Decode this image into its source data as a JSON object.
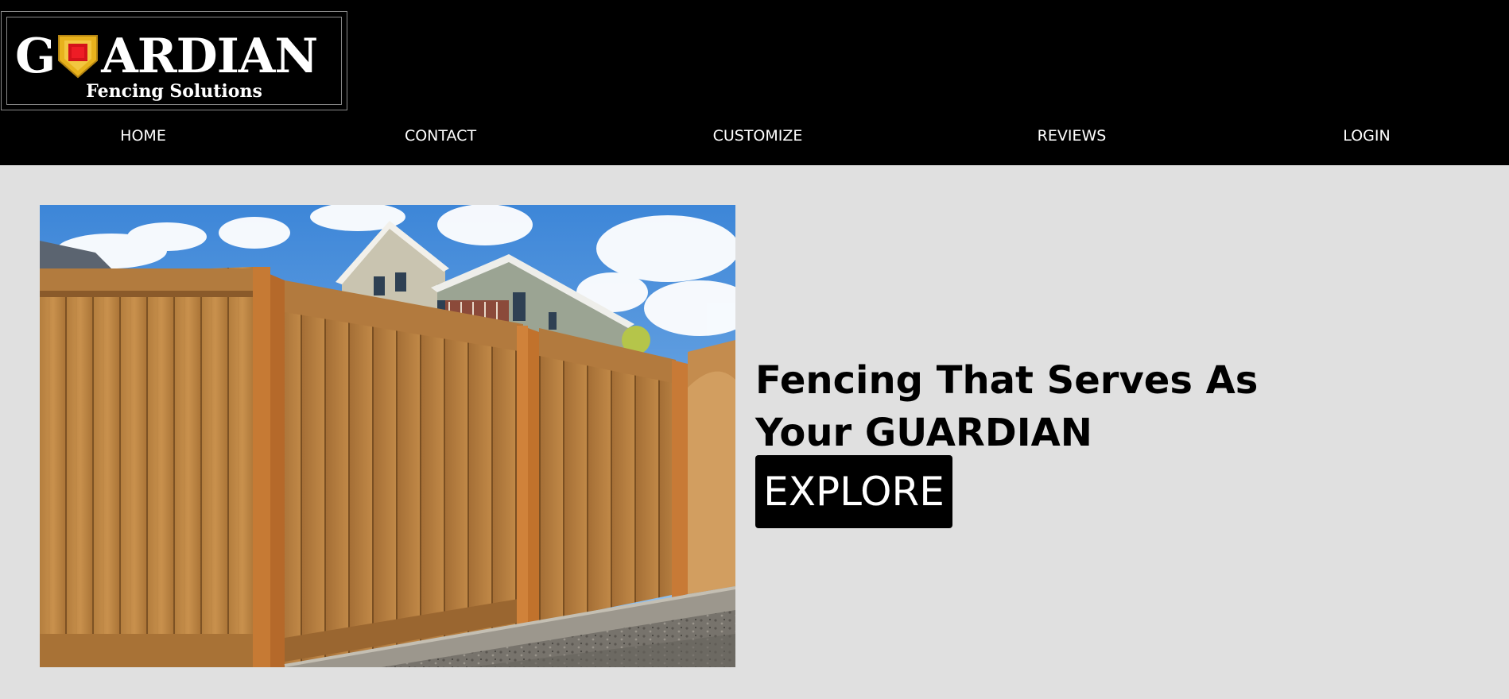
{
  "logo": {
    "word_left": "G",
    "word_right": "ARDIAN",
    "subtitle": "Fencing Solutions",
    "alt": "GUARDIAN Fencing Solutions",
    "shield_colors": {
      "outer": "#e8b21c",
      "inner": "#d4121a"
    }
  },
  "nav": {
    "items": [
      "HOME",
      "CONTACT",
      "CUSTOMIZE",
      "REVIEWS",
      "LOGIN"
    ]
  },
  "hero": {
    "heading": "Fencing That Serves As Your GUARDIAN",
    "button_label": "EXPLORE",
    "image_alt": "Wooden privacy fence in front of a house"
  },
  "colors": {
    "header_bg": "#000000",
    "page_bg": "#e0e0e0",
    "button_bg": "#000000",
    "text_light": "#ffffff"
  }
}
